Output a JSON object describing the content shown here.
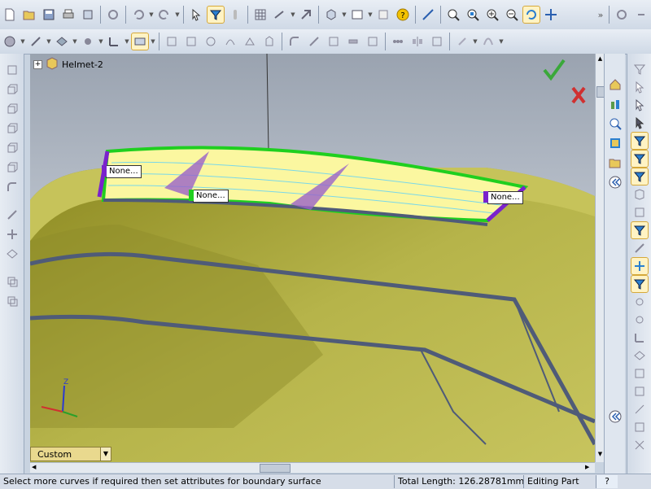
{
  "tree": {
    "root_label": "Helmet-2",
    "expander": "+"
  },
  "callouts": [
    {
      "label": "None..."
    },
    {
      "label": "None..."
    },
    {
      "label": "None..."
    }
  ],
  "display_state": {
    "label": "Custom"
  },
  "status": {
    "message": "Select more curves if required then set attributes for boundary surface",
    "total_length": "Total Length: 126.28781mm",
    "mode": "Editing Part",
    "help": "?"
  },
  "colors": {
    "surface_preview": "#fbf7a0",
    "boundary_green": "#1fcf1f",
    "connector_purple": "#7a22cc",
    "model_olive": "#a8a63a",
    "confirm_green": "#3aa83a",
    "cancel_red": "#d03030"
  },
  "icons": {
    "toolbar_top": [
      "new-icon",
      "open-icon",
      "save-icon",
      "print-icon",
      "undo-icon",
      "redo-icon",
      "select-icon",
      "filter-icon",
      "rebuild-icon",
      "options-icon",
      "help-icon",
      "zoom-fit-icon",
      "zoom-area-icon",
      "zoom-in-icon",
      "zoom-out-icon",
      "rotate-icon",
      "pan-icon"
    ],
    "toolbar_second": [
      "sketch-icon",
      "dimension-icon",
      "plane-icon",
      "axis-icon",
      "feature-icon",
      "surface-icon",
      "fillet-icon",
      "pattern-icon"
    ],
    "left": [
      "box-icon",
      "extrude-icon",
      "revolve-icon",
      "sweep-icon",
      "loft-icon",
      "boundary-icon",
      "fillet-icon",
      "chamfer-icon",
      "sketch-line-icon",
      "point-icon",
      "plane-icon",
      "copy-icon",
      "delete-icon"
    ],
    "right": [
      "filter-icon",
      "select-vertex-icon",
      "select-edge-icon",
      "select-face-icon",
      "filter-edges-icon",
      "filter-faces-icon",
      "filter-bodies-icon",
      "select-icon",
      "expand-icon"
    ]
  }
}
